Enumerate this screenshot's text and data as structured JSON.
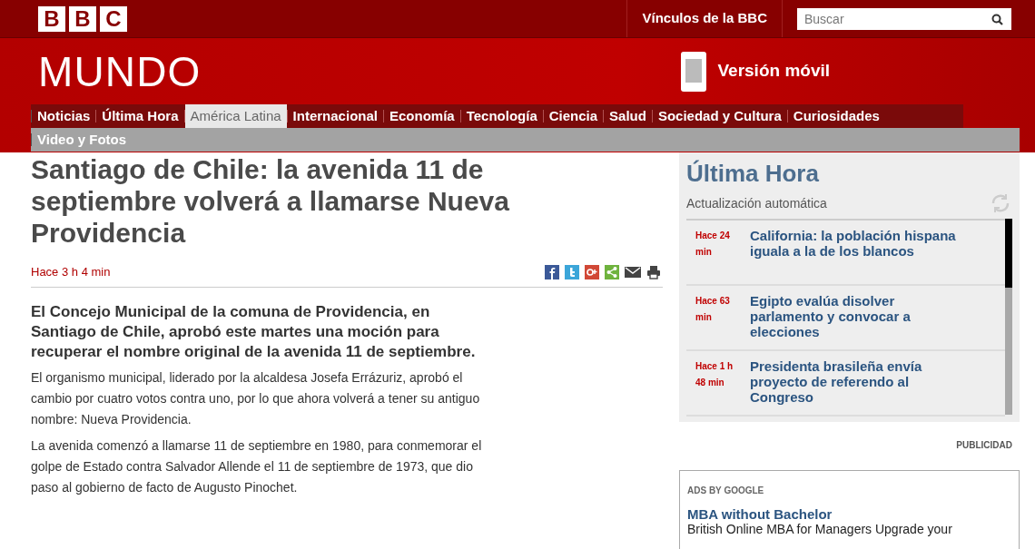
{
  "header": {
    "logo_letters": [
      "B",
      "B",
      "C"
    ],
    "links_label": "Vínculos de la BBC",
    "search": {
      "placeholder": "Buscar"
    },
    "section_title": "MUNDO",
    "mobile_link": "Versión móvil"
  },
  "nav": [
    {
      "label": "Noticias",
      "selected": false
    },
    {
      "label": "Última Hora",
      "selected": false
    },
    {
      "label": "América Latina",
      "selected": true
    },
    {
      "label": "Internacional",
      "selected": false
    },
    {
      "label": "Economía",
      "selected": false
    },
    {
      "label": "Tecnología",
      "selected": false
    },
    {
      "label": "Ciencia",
      "selected": false
    },
    {
      "label": "Salud",
      "selected": false
    },
    {
      "label": "Sociedad y Cultura",
      "selected": false
    },
    {
      "label": "Curiosidades",
      "selected": false
    },
    {
      "label": "Video y Fotos",
      "selected": false
    }
  ],
  "article": {
    "headline": "Santiago de Chile: la avenida 11 de septiembre volverá a llamarse Nueva Providencia",
    "time": "Hace 3 h 4 min",
    "share": [
      {
        "kind": "facebook"
      },
      {
        "kind": "twitter"
      },
      {
        "kind": "googleplus"
      },
      {
        "kind": "share"
      },
      {
        "kind": "email"
      },
      {
        "kind": "print"
      }
    ],
    "lead": "El Concejo Municipal de la comuna de Providencia, en Santiago de Chile, aprobó este martes una moción para recuperar el nombre original de la avenida 11 de septiembre.",
    "paragraphs": [
      "El organismo municipal, liderado por la alcaldesa Josefa Errázuriz, aprobó el cambio por cuatro votos contra uno, por lo que ahora volverá a tener su antiguo nombre: Nueva Providencia.",
      "La avenida comenzó a llamarse 11 de septiembre en 1980, para conmemorar el golpe de Estado contra Salvador Allende el 11 de septiembre de 1973, que dio paso al gobierno de facto de Augusto Pinochet."
    ]
  },
  "latest": {
    "title": "Última Hora",
    "subtitle": "Actualización automática",
    "items": [
      {
        "time": "Hace 24 min",
        "headline": "California: la población hispana iguala a la de los blancos"
      },
      {
        "time": "Hace 63 min",
        "headline": "Egipto evalúa disolver parlamento y convocar a elecciones"
      },
      {
        "time": "Hace 1 h 48 min",
        "headline": "Presidenta brasileña envía proyecto de referendo al Congreso"
      }
    ]
  },
  "advertising": {
    "label": "PUBLICIDAD",
    "ads_label": "ADS BY GOOGLE",
    "ad_title": "MBA without Bachelor",
    "ad_text": "British Online MBA for Managers Upgrade your"
  }
}
